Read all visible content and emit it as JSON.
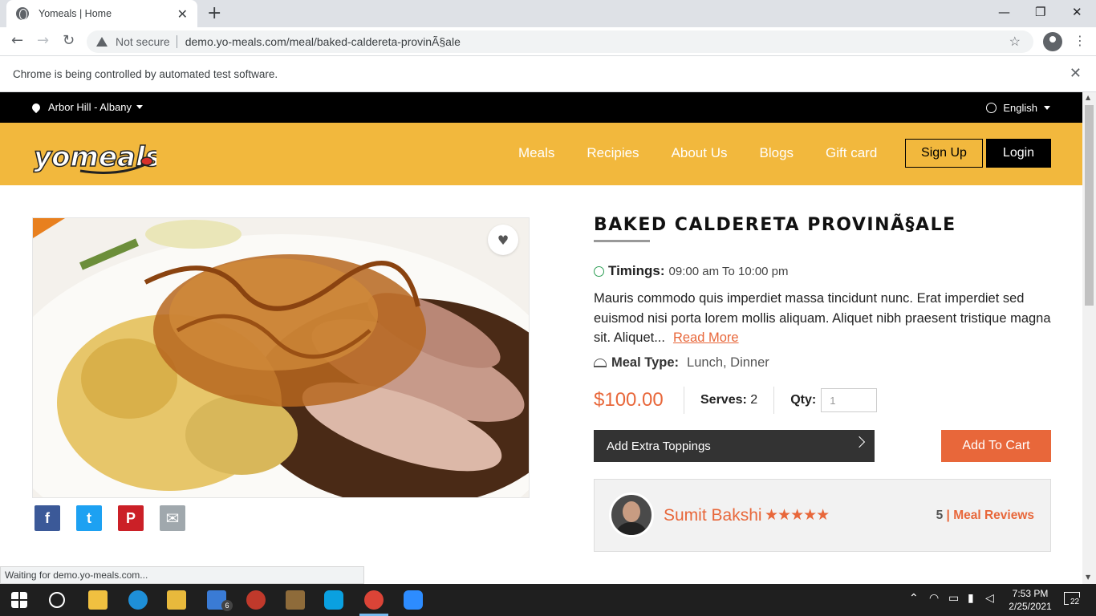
{
  "browser": {
    "tab_title": "Yomeals | Home",
    "security_label": "Not secure",
    "url": "demo.yo-meals.com/meal/baked-caldereta-provinÃ§ale",
    "infobar_text": "Chrome is being controlled by automated test software.",
    "status_text": "Waiting for demo.yo-meals.com..."
  },
  "topbar": {
    "location": "Arbor Hill - Albany",
    "language": "English"
  },
  "header": {
    "logo_text": "yomeals",
    "nav": [
      "Meals",
      "Recipies",
      "About Us",
      "Blogs",
      "Gift card"
    ],
    "signup_label": "Sign Up",
    "login_label": "Login"
  },
  "meal": {
    "title": "BAKED CALDERETA PROVINÃ§ALE",
    "timings_label": "Timings:",
    "timings_value": "09:00 am To 10:00 pm",
    "description": "Mauris commodo quis imperdiet massa tincidunt nunc. Erat imperdiet sed euismod nisi porta lorem mollis aliquam. Aliquet nibh praesent tristique magna sit. Aliquet...",
    "read_more": "Read More",
    "meal_type_label": "Meal Type:",
    "meal_type_value": "Lunch, Dinner",
    "price": "$100.00",
    "serves_label": "Serves:",
    "serves_value": "2",
    "qty_label": "Qty:",
    "qty_value": "1",
    "toppings_label": "Add Extra Toppings",
    "add_to_cart_label": "Add To Cart"
  },
  "share": {
    "facebook": "f",
    "twitter": "t",
    "pinterest": "P",
    "email": "✉"
  },
  "chef": {
    "name": "Sumit Bakshi",
    "stars": "★★★★★",
    "rating": 5,
    "review_count": "5",
    "review_separator": "|",
    "reviews_label": "Meal Reviews"
  },
  "taskbar": {
    "time": "7:53 PM",
    "date": "2/25/2021",
    "mail_badge": "6",
    "notification_count": "22"
  },
  "colors": {
    "brand_yellow": "#f2b83d",
    "accent_orange": "#e8673a",
    "facebook": "#3b5998",
    "twitter": "#1da1f2",
    "pinterest": "#cb2027",
    "email": "#a0a8ad"
  }
}
